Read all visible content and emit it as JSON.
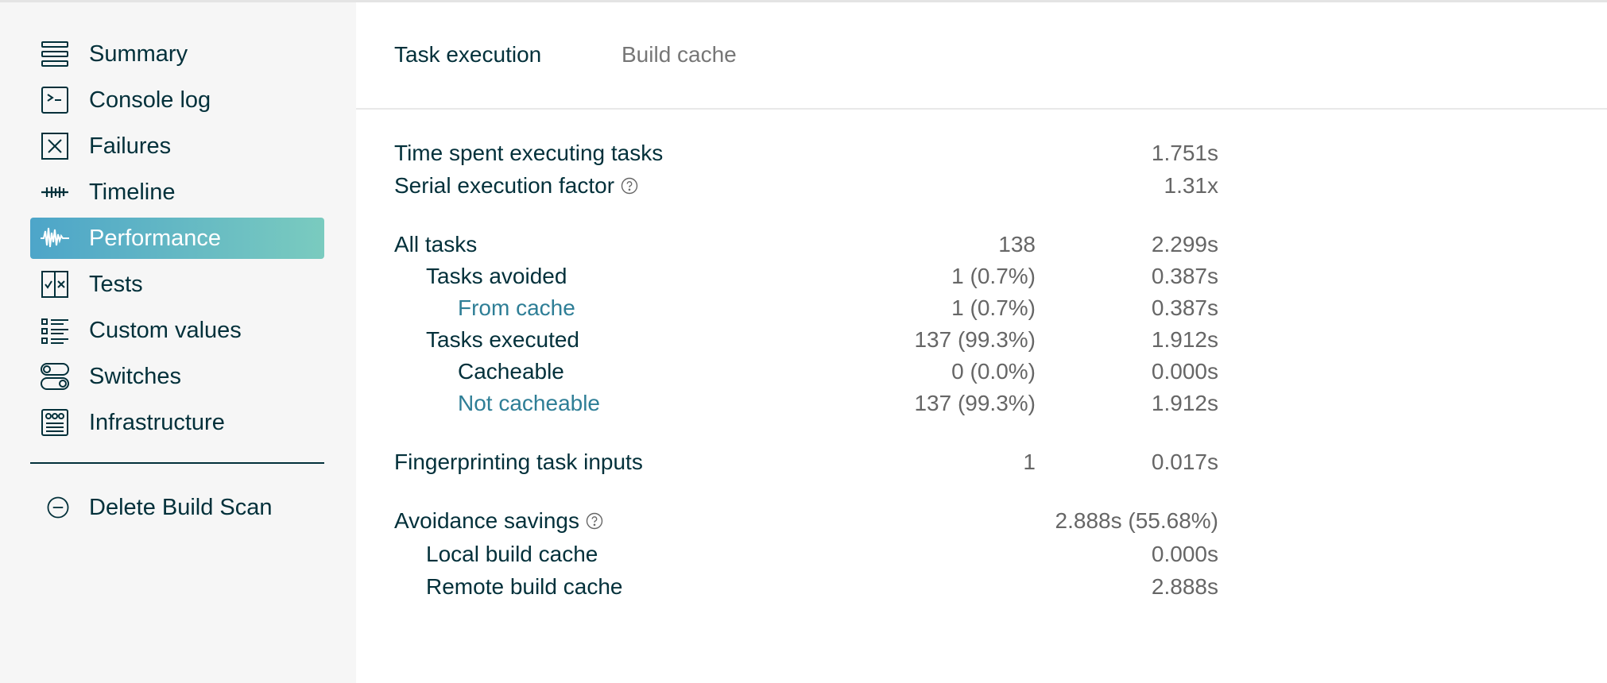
{
  "sidebar": {
    "items": [
      {
        "label": "Summary",
        "icon": "summary-icon"
      },
      {
        "label": "Console log",
        "icon": "console-icon"
      },
      {
        "label": "Failures",
        "icon": "failures-icon"
      },
      {
        "label": "Timeline",
        "icon": "timeline-icon"
      },
      {
        "label": "Performance",
        "icon": "performance-icon",
        "active": true
      },
      {
        "label": "Tests",
        "icon": "tests-icon"
      },
      {
        "label": "Custom values",
        "icon": "custom-values-icon"
      },
      {
        "label": "Switches",
        "icon": "switches-icon"
      },
      {
        "label": "Infrastructure",
        "icon": "infrastructure-icon"
      }
    ],
    "delete_label": "Delete Build Scan"
  },
  "tabs": {
    "task_execution": "Task execution",
    "build_cache": "Build cache"
  },
  "metrics": {
    "time_spent": {
      "label": "Time spent executing tasks",
      "time": "1.751s"
    },
    "serial_factor": {
      "label": "Serial execution factor",
      "time": "1.31x"
    },
    "all_tasks": {
      "label": "All tasks",
      "count": "138",
      "time": "2.299s"
    },
    "tasks_avoided": {
      "label": "Tasks avoided",
      "count": "1 (0.7%)",
      "time": "0.387s"
    },
    "from_cache": {
      "label": "From cache",
      "count": "1 (0.7%)",
      "time": "0.387s"
    },
    "tasks_executed": {
      "label": "Tasks executed",
      "count": "137 (99.3%)",
      "time": "1.912s"
    },
    "cacheable": {
      "label": "Cacheable",
      "count": "0 (0.0%)",
      "time": "0.000s"
    },
    "not_cacheable": {
      "label": "Not cacheable",
      "count": "137 (99.3%)",
      "time": "1.912s"
    },
    "fingerprinting": {
      "label": "Fingerprinting task inputs",
      "count": "1",
      "time": "0.017s"
    },
    "avoidance_savings": {
      "label": "Avoidance savings",
      "time": "2.888s (55.68%)"
    },
    "local_cache": {
      "label": "Local build cache",
      "time": "0.000s"
    },
    "remote_cache": {
      "label": "Remote build cache",
      "time": "2.888s"
    }
  },
  "colors": {
    "text": "#02303a",
    "muted": "#666666",
    "link": "#2e7e96",
    "active_gradient_start": "#4da5c9",
    "active_gradient_end": "#7acbbf"
  }
}
